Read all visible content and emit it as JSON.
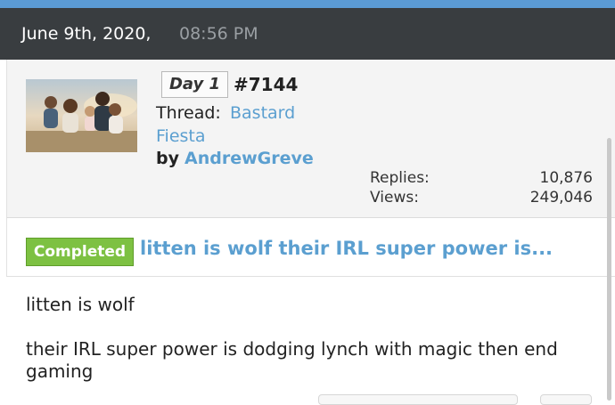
{
  "header": {
    "date": "June 9th, 2020,",
    "time": "08:56 PM"
  },
  "thread": {
    "day_badge": "Day 1",
    "number": "#7144",
    "thread_label": "Thread:",
    "thread_title_line1": "Bastard",
    "thread_title_line2": "Fiesta",
    "by_label": "by",
    "author": "AndrewGreve",
    "stats": {
      "replies_label": "Replies:",
      "replies_value": "10,876",
      "views_label": "Views:",
      "views_value": "249,046"
    }
  },
  "post": {
    "status_badge": "Completed",
    "title": "litten is wolf their IRL super power is...",
    "body_line1": "litten is wolf",
    "body_line2": "their IRL super power is dodging lynch with magic then end gaming"
  },
  "colors": {
    "header_bg": "#393d40",
    "accent_strip": "#5b9bd5",
    "link": "#5b9fd0",
    "completed": "#7dc142"
  }
}
